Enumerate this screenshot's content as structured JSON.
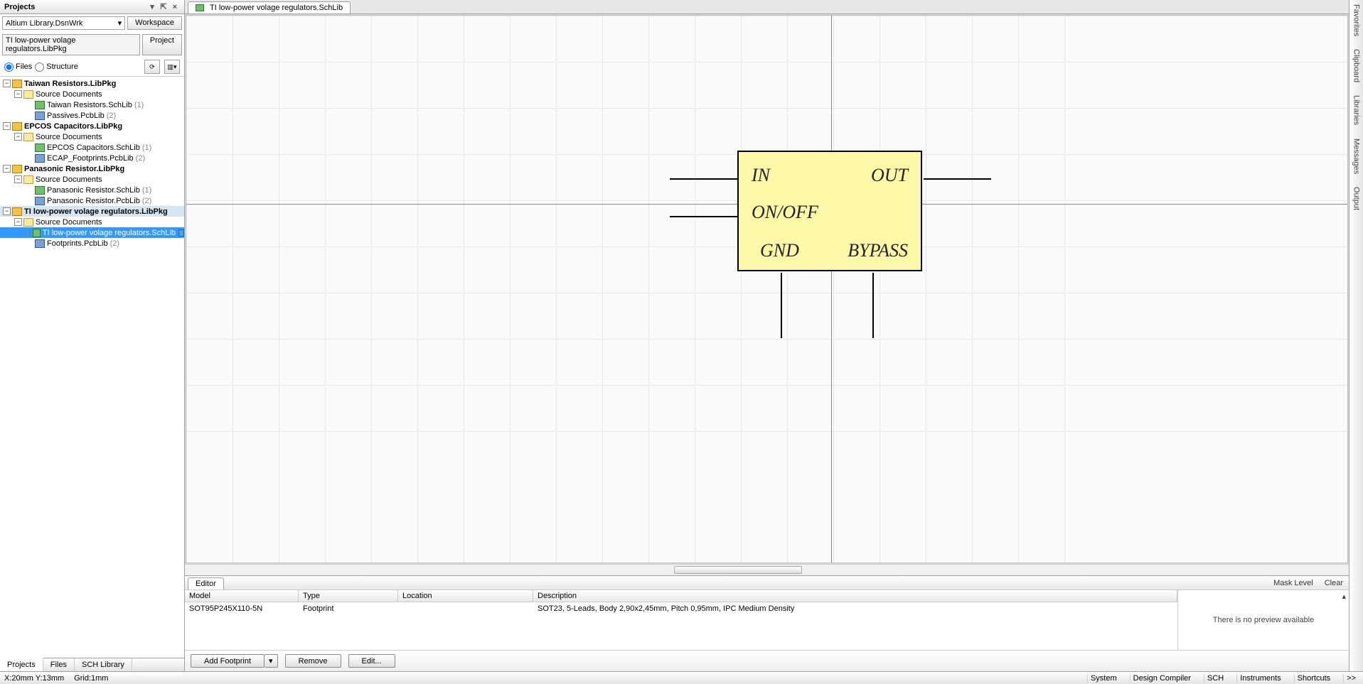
{
  "left_panel": {
    "title": "Projects",
    "workspace_combo": "Altium Library.DsnWrk",
    "workspace_btn": "Workspace",
    "project_field": "TI low-power volage regulators.LibPkg",
    "project_btn": "Project",
    "mode_files": "Files",
    "mode_structure": "Structure",
    "tabs": [
      "Projects",
      "Files",
      "SCH Library"
    ]
  },
  "tree": [
    {
      "lvl": 0,
      "exp": "-",
      "icon": "prj",
      "label": "Taiwan Resistors.LibPkg",
      "bold": true
    },
    {
      "lvl": 1,
      "exp": "-",
      "icon": "fld",
      "label": "Source Documents"
    },
    {
      "lvl": 2,
      "exp": "",
      "icon": "sch",
      "label": "Taiwan Resistors.SchLib",
      "count": "(1)"
    },
    {
      "lvl": 2,
      "exp": "",
      "icon": "pcb",
      "label": "Passives.PcbLib",
      "count": "(2)"
    },
    {
      "lvl": 0,
      "exp": "-",
      "icon": "prj",
      "label": "EPCOS Capacitors.LibPkg",
      "bold": true
    },
    {
      "lvl": 1,
      "exp": "-",
      "icon": "fld",
      "label": "Source Documents"
    },
    {
      "lvl": 2,
      "exp": "",
      "icon": "sch",
      "label": "EPCOS Capacitors.SchLib",
      "count": "(1)"
    },
    {
      "lvl": 2,
      "exp": "",
      "icon": "pcb",
      "label": "ECAP_Footprints.PcbLib",
      "count": "(2)"
    },
    {
      "lvl": 0,
      "exp": "-",
      "icon": "prj",
      "label": "Panasonic Resistor.LibPkg",
      "bold": true
    },
    {
      "lvl": 1,
      "exp": "-",
      "icon": "fld",
      "label": "Source Documents"
    },
    {
      "lvl": 2,
      "exp": "",
      "icon": "sch",
      "label": "Panasonic Resistor.SchLib",
      "count": "(1)"
    },
    {
      "lvl": 2,
      "exp": "",
      "icon": "pcb",
      "label": "Panasonic Resistor.PcbLib",
      "count": "(2)"
    },
    {
      "lvl": 0,
      "exp": "-",
      "icon": "prj",
      "label": "TI low-power volage regulators.LibPkg",
      "bold": true,
      "selgrp": true
    },
    {
      "lvl": 1,
      "exp": "-",
      "icon": "fld",
      "label": "Source Documents"
    },
    {
      "lvl": 2,
      "exp": "",
      "icon": "sch",
      "label": "TI low-power volage regulators.SchLib",
      "sel": true,
      "mark": true
    },
    {
      "lvl": 2,
      "exp": "",
      "icon": "pcb",
      "label": "Footprints.PcbLib",
      "count": "(2)"
    }
  ],
  "doc_tab": "TI low-power volage regulators.SchLib",
  "component": {
    "pins": {
      "in": "IN",
      "out": "OUT",
      "onoff": "ON/OFF",
      "gnd": "GND",
      "bypass": "BYPASS"
    }
  },
  "editor": {
    "tab": "Editor",
    "mask": "Mask Level",
    "clear": "Clear",
    "headers": {
      "model": "Model",
      "type": "Type",
      "location": "Location",
      "description": "Description"
    },
    "row": {
      "model": "SOT95P245X110-5N",
      "type": "Footprint",
      "location": "",
      "description": "SOT23, 5-Leads, Body 2,90x2,45mm, Pitch 0,95mm, IPC Medium Density"
    },
    "preview_msg": "There is no preview available",
    "btn_add": "Add Footprint",
    "btn_remove": "Remove",
    "btn_edit": "Edit..."
  },
  "right_tabs": [
    "Favorites",
    "Clipboard",
    "Libraries",
    "Messages",
    "Output"
  ],
  "status": {
    "coords": "X:20mm Y:13mm",
    "grid": "Grid:1mm",
    "links": [
      "System",
      "Design Compiler",
      "SCH",
      "Instruments",
      "Shortcuts",
      ">>"
    ]
  }
}
